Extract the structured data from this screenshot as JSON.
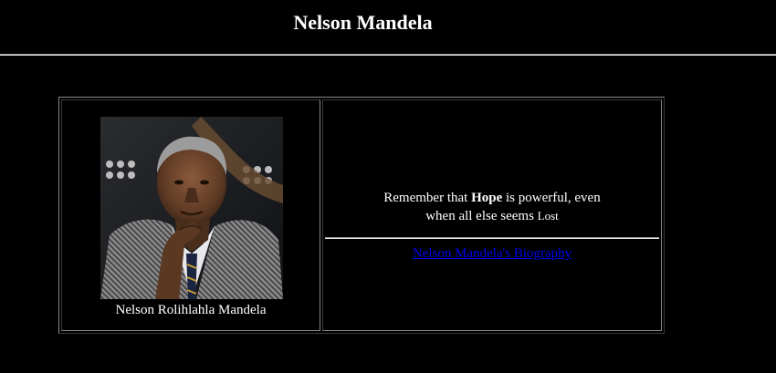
{
  "header": {
    "title": "Nelson Mandela"
  },
  "portrait": {
    "image_alt": "Nelson Mandela portrait",
    "caption": "Nelson Rolihlahla Mandela"
  },
  "quote": {
    "part1": "Remember that ",
    "emphasis": "Hope",
    "part2": " is powerful, even",
    "part3": "when all else seems ",
    "last_word": "Lost"
  },
  "link": {
    "label": "Nelson Mandela's Biography",
    "color": "#0000ee"
  },
  "colors": {
    "background": "#000000",
    "text": "#ffffff"
  }
}
